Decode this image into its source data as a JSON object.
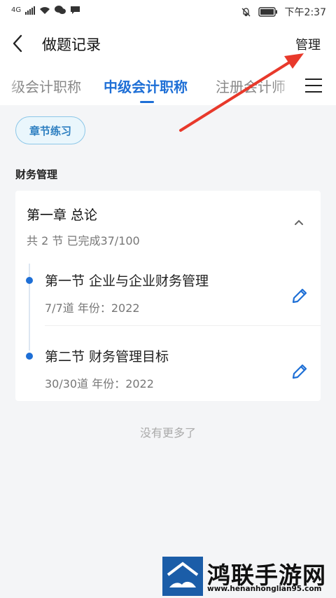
{
  "status_bar": {
    "network": "4G",
    "time": "下午2:37"
  },
  "header": {
    "title": "做题记录",
    "manage_label": "管理"
  },
  "tabs": [
    {
      "label": "级会计职称",
      "active": false
    },
    {
      "label": "中级会计职称",
      "active": true
    },
    {
      "label": "注册会计师",
      "active": false
    }
  ],
  "filter_chip": "章节练习",
  "subject": "财务管理",
  "chapter": {
    "name": "第一章 总论",
    "progress": "共 2 节  已完成37/100",
    "sections": [
      {
        "name": "第一节  企业与企业财务管理",
        "meta": "7/7道   年份：2022"
      },
      {
        "name": "第二节  财务管理目标",
        "meta": "30/30道   年份：2022"
      }
    ]
  },
  "footer_text": "没有更多了",
  "watermark": {
    "name": "鸿联手游网",
    "url": "www.henanhonglian95.com"
  },
  "colors": {
    "accent": "#1e6fd6",
    "chip_border": "#8cc7e8",
    "arrow": "#e8392b"
  }
}
